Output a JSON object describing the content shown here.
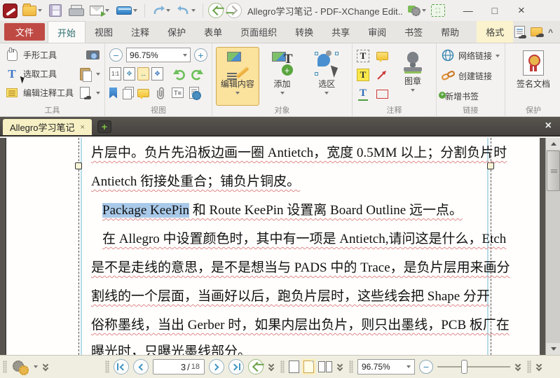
{
  "titlebar": {
    "title": "Allegro学习笔记 - PDF-XChange Edit.."
  },
  "glyphs": {
    "min": "—",
    "max": "□",
    "close": "×",
    "tab_close": "×",
    "newtab": "+",
    "collapse": "^",
    "one2one": "1:1",
    "T": "T",
    "plus": "+",
    "minus": "−",
    "slash": "/",
    "fit_arrows": "↔",
    "fit_all": "✥"
  },
  "ribbon_tabs": {
    "file": "文件",
    "home": "开始",
    "view": "视图",
    "comment": "注释",
    "protect": "保护",
    "form": "表单",
    "organize": "页面组织",
    "convert": "转换",
    "share": "共享",
    "review": "审阅",
    "bookmarks": "书签",
    "help": "帮助",
    "format": "格式"
  },
  "ribbon": {
    "tools": {
      "label": "工具",
      "hand": "手形工具",
      "select": "选取工具",
      "edit_comment": "编辑注释工具"
    },
    "view": {
      "label": "视图",
      "zoom": "96.75%"
    },
    "object": {
      "label": "对象",
      "edit_content": "编辑内容",
      "add": "添加",
      "selection": "选区"
    },
    "comment": {
      "label": "注释",
      "stamp": "图章"
    },
    "links": {
      "label": "链接",
      "weblink": "网络链接",
      "createlink": "创建链接",
      "addbookmark": "新增书签"
    },
    "protect": {
      "label": "保护",
      "sign": "签名文档"
    }
  },
  "doctab": {
    "title": "Allegro学习笔记"
  },
  "document": {
    "lines": {
      "l1": "片层中。负片先沿板边画一圈 Antietch，宽度 0.5MM 以上；分割负片时",
      "l2": "Antietch 衔接处重合；铺负片铜皮。",
      "l3_highlight": "Package KeePin",
      "l3_rest": " 和 Route KeePin 设置离 Board Outline 远一点。",
      "l4": "在 Allegro 中设置颜色时，其中有一项是 Antietch,请问这是什么，Etch",
      "l5": "是不是走线的意思，是不是想当与 PADS 中的 Trace，是负片层用来画分",
      "l6": "割线的一个层面，当画好以后，跑负片层时，这些线会把 Shape 分开",
      "l7": "俗称墨线，当出 Gerber 时，如果内层出负片，则只出墨线，PCB 板厂在",
      "l8": "曝光时，只曝光墨线部分。"
    }
  },
  "statusbar": {
    "page": "3",
    "page_total": "18",
    "zoom": "96.75%"
  },
  "colors": {
    "accent_red": "#bf4a44",
    "active_doc_tab": "#f7f0c4",
    "selection_highlight": "#a9c9e9",
    "selected_tool": "#fbe29d",
    "format_tab": "#faf3cd"
  }
}
